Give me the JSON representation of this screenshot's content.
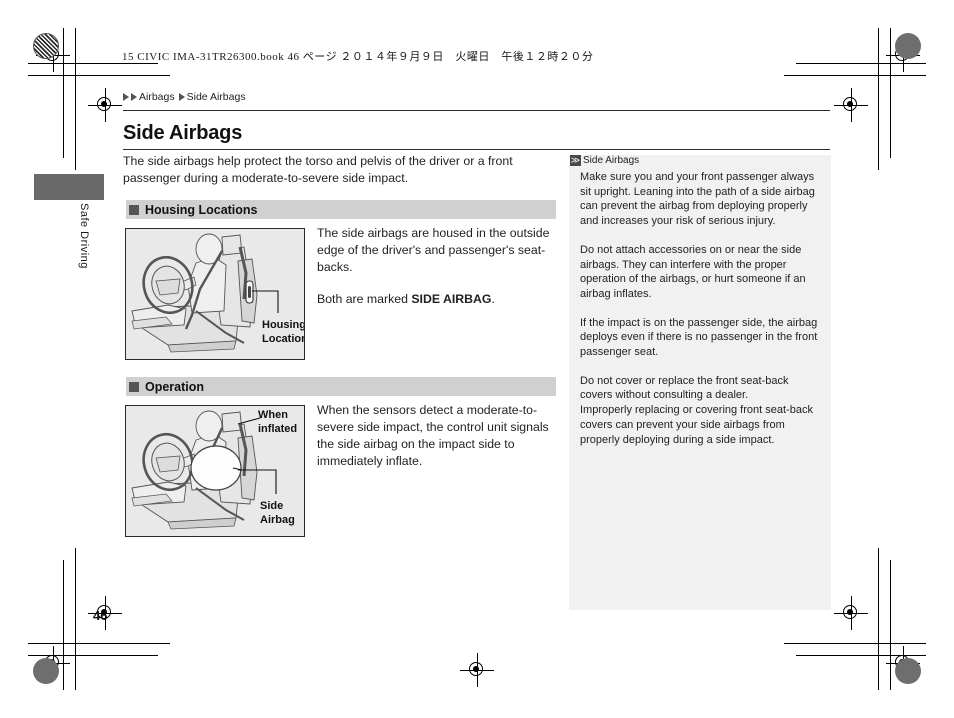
{
  "print_header": "15 CIVIC IMA-31TR26300.book  46 ページ  ２０１４年９月９日　火曜日　午後１２時２０分",
  "tab": {
    "label": "Safe Driving"
  },
  "breadcrumb": {
    "items": [
      "Airbags",
      "Side Airbags"
    ]
  },
  "page": {
    "title": "Side Airbags",
    "number": "46",
    "intro": "The side airbags help protect the torso and pelvis of the driver or a front passenger during a moderate-to-severe side impact."
  },
  "sections": [
    {
      "heading": "Housing Locations",
      "figure": {
        "caption_lines": [
          "Housing",
          "Location"
        ],
        "alt": "driver-seated-side-airbag-housing-illustration"
      },
      "paragraphs": [
        "The side airbags are housed in the outside edge of the driver's and passenger's seat-backs.",
        "Both are marked SIDE AIRBAG."
      ],
      "para1": "The side airbags are housed in the outside edge of the driver's and passenger's seat-backs.",
      "para2_prefix": "Both are marked ",
      "para2_bold": "SIDE AIRBAG",
      "para2_suffix": "."
    },
    {
      "heading": "Operation",
      "figure": {
        "caption_lines_top": [
          "When",
          "inflated"
        ],
        "caption_lines_bottom": [
          "Side",
          "Airbag"
        ],
        "alt": "driver-seated-side-airbag-inflated-illustration"
      },
      "paragraph": "When the sensors detect a moderate-to-severe side impact, the control unit signals the side airbag on the impact side to immediately inflate."
    }
  ],
  "note_panel": {
    "icon": "≫",
    "heading": "Side Airbags",
    "paragraphs": [
      "Make sure you and your front passenger always sit upright. Leaning into the path of a side airbag can prevent the airbag from deploying properly and increases your risk of serious injury.",
      "Do not attach accessories on or near the side airbags. They can interfere with the proper operation of the airbags, or hurt someone if an airbag inflates.",
      "If the impact is on the passenger side, the airbag deploys even if there is no passenger in the front passenger seat.",
      "Do not cover or replace the front seat-back covers without consulting a dealer.\nImproperly replacing or covering front seat-back covers can prevent your side airbags from properly deploying during a side impact."
    ]
  },
  "colors": {
    "section_bar": "#d0d0d0",
    "note_panel": "#f1f1f1",
    "tab_block": "#6a6a6a",
    "figure_bg": "#e9e9e9",
    "text": "#222222"
  }
}
